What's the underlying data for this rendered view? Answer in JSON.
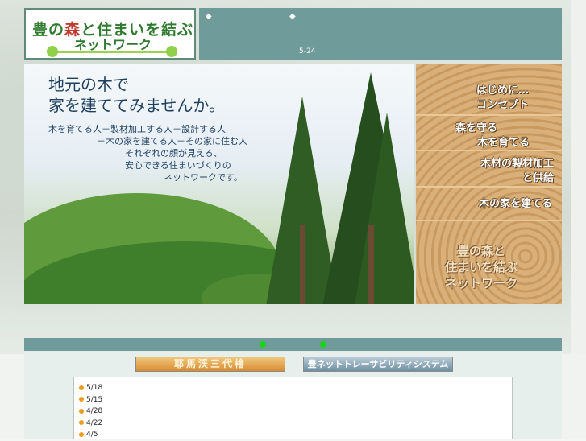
{
  "header": {
    "logo_line1_a": "豊の",
    "logo_line1_mori": "森",
    "logo_line1_b": "と住まいを結ぶ",
    "logo_line2": "ネットワーク",
    "nav_markers": [
      "◆",
      "◆"
    ],
    "date": "5-24"
  },
  "hero": {
    "title_line1": "地元の木で",
    "title_line2": "家を建ててみませんか。",
    "sub_lines": [
      "木を育てる人－製材加工する人－設計する人",
      "－木の家を建てる人－その家に住む人",
      "それぞれの顔が見える、",
      "安心できる住まいづくりの",
      "ネットワークです。"
    ]
  },
  "menu": {
    "items": [
      {
        "line1": "はじめに…",
        "line2": "コンセプト"
      },
      {
        "line1": "森を守る",
        "line2": "木を育てる"
      },
      {
        "line1": "木材の製材加工",
        "line2": "と供給"
      },
      {
        "line1": "木の家を建てる",
        "line2": ""
      }
    ],
    "tagline": [
      "豊の森と",
      "住まいを結ぶ",
      "ネットワーク"
    ]
  },
  "buttons": {
    "yaba": "耶馬渓三代檜",
    "trace": "豊ネットトレーサビリティシステム"
  },
  "news": {
    "dates": [
      "5/18",
      "5/15",
      "4/28",
      "4/22",
      "4/5"
    ]
  },
  "colors": {
    "band": "#6f9b9a",
    "logo_green": "#2f7a2f",
    "accent_red": "#c0392b",
    "bullet_orange": "#f19a1c",
    "dot_green": "#19d419"
  }
}
